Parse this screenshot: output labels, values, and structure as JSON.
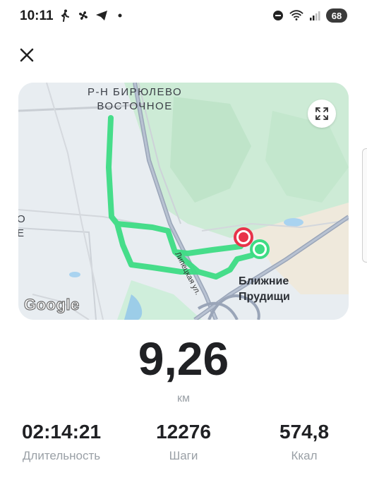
{
  "status_bar": {
    "time": "10:11",
    "battery": "68",
    "icons": [
      "walk-icon",
      "fan-icon",
      "send-icon",
      "dot-icon",
      "dnd-icon",
      "wifi-icon",
      "signal-icon"
    ]
  },
  "map": {
    "district_label_line1": "Р-Н БИРЮЛЕВО",
    "district_label_line2": "ВОСТОЧНОЕ",
    "place_label_line1": "Ближние",
    "place_label_line2": "Прудищи",
    "street_label": "Липецкая ул.",
    "edge_label_line1": "О",
    "edge_label_line2": "Е",
    "logo": "Google",
    "route_color": "#3ddc84",
    "start_marker_color": "#3ddc84",
    "end_marker_color": "#e8334a"
  },
  "summary": {
    "distance": "9,26",
    "distance_unit": "км"
  },
  "stats": [
    {
      "value": "02:14:21",
      "label": "Длительность"
    },
    {
      "value": "12276",
      "label": "Шаги"
    },
    {
      "value": "574,8",
      "label": "Ккал"
    }
  ]
}
